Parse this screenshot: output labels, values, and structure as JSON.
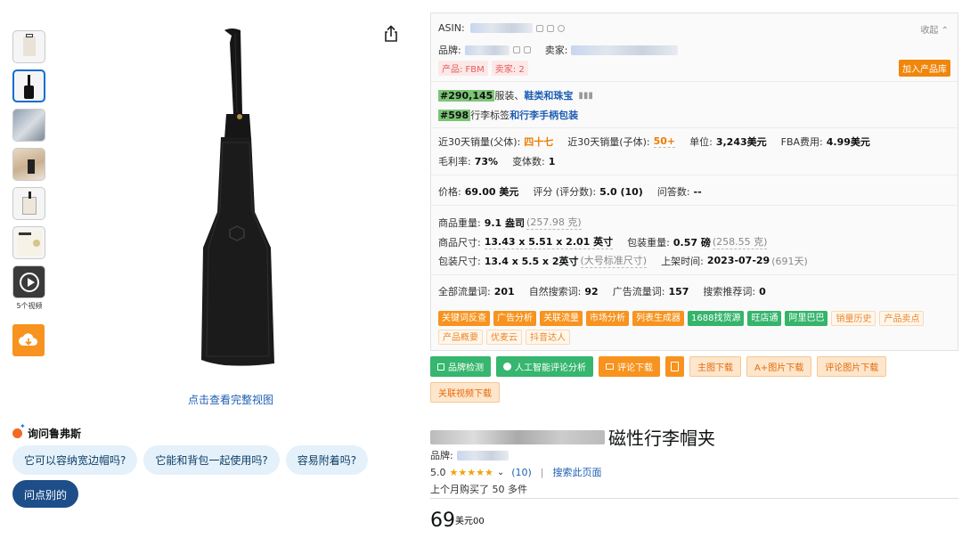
{
  "thumbs": {
    "video_count": "5个视频"
  },
  "main_image": {
    "full_view_link": "点击查看完整视图"
  },
  "rufus": {
    "title": "询问鲁弗斯",
    "chips": [
      "它可以容纳宽边帽吗?",
      "它能和背包一起使用吗?",
      "容易附着吗?"
    ],
    "ask_other": "问点别的"
  },
  "panel": {
    "asin_label": "ASIN:",
    "collapse": "收起",
    "brand_label": "品牌:",
    "seller_label": "卖家:",
    "tag_product": "产品: FBM",
    "tag_seller": "卖家: 2",
    "add_to_library": "加入产品库",
    "rank1_num": "#290,145",
    "rank1_cat_a": "服装、",
    "rank1_cat_b": "鞋类和珠宝",
    "rank2_num": "#598",
    "rank2_cat_a": "行李标签",
    "rank2_cat_b": "和行李手柄包装",
    "sales_parent_label": "近30天销量(父体):",
    "sales_parent_value": "四十七",
    "sales_child_label": "近30天销量(子体):",
    "sales_child_value": "50+",
    "unit_label": "单位:",
    "unit_value": "3,243美元",
    "fba_label": "FBA费用:",
    "fba_value": "4.99美元",
    "margin_label": "毛利率:",
    "margin_value": "73%",
    "variants_label": "变体数:",
    "variants_value": "1",
    "price_label": "价格:",
    "price_value": "69.00 美元",
    "rating_label": "评分 (评分数):",
    "rating_value": "5.0 (10)",
    "qa_label": "问答数:",
    "qa_value": "--",
    "weight_label": "商品重量:",
    "weight_value": "9.1 盎司",
    "weight_alt": "(257.98 克)",
    "size_label": "商品尺寸:",
    "size_value": "13.43 x 5.51 x 2.01 英寸",
    "pkg_weight_label": "包装重量:",
    "pkg_weight_value": "0.57 磅",
    "pkg_weight_alt": "(258.55 克)",
    "pkg_size_label": "包装尺寸:",
    "pkg_size_value": "13.4 x 5.5 x 2英寸",
    "pkg_size_alt": "(大号标准尺寸)",
    "listed_label": "上架时间:",
    "listed_value": "2023-07-29",
    "listed_alt": "(691天)",
    "traffic_all_label": "全部流量词:",
    "traffic_all_value": "201",
    "traffic_organic_label": "自然搜索词:",
    "traffic_organic_value": "92",
    "traffic_ad_label": "广告流量词:",
    "traffic_ad_value": "157",
    "traffic_suggest_label": "搜索推荐词:",
    "traffic_suggest_value": "0",
    "tools": [
      {
        "label": "关键词反查",
        "style": "orange"
      },
      {
        "label": "广告分析",
        "style": "orange"
      },
      {
        "label": "关联流量",
        "style": "orange"
      },
      {
        "label": "市场分析",
        "style": "orange"
      },
      {
        "label": "列表生成器",
        "style": "orange"
      },
      {
        "label": "1688找货源",
        "style": "green"
      },
      {
        "label": "旺店通",
        "style": "green"
      },
      {
        "label": "阿里巴巴",
        "style": "green"
      },
      {
        "label": "销量历史",
        "style": "outline"
      },
      {
        "label": "产品卖点",
        "style": "outline"
      },
      {
        "label": "产品概要",
        "style": "outline"
      },
      {
        "label": "优麦云",
        "style": "outline"
      },
      {
        "label": "抖音达人",
        "style": "outline"
      }
    ]
  },
  "actions": {
    "brand_check": "品牌检测",
    "ai_review": "人工智能评论分析",
    "review_download": "评论下载",
    "main_img_download": "主图下载",
    "aplus_download": "A+图片下载",
    "review_img_download": "评论图片下载",
    "related_video_download": "关联视频下载"
  },
  "product": {
    "title_suffix": "磁性行李帽夹",
    "brand_label": "品牌:",
    "rating": "5.0",
    "rating_count": "(10)",
    "search_page": "搜索此页面",
    "bought": "上个月购买了 50 多件",
    "price_whole": "69",
    "price_fraction": "美元00"
  },
  "colors": {
    "accent_orange": "#f7931e",
    "accent_green": "#35b46b",
    "link_blue": "#1f5fb4"
  }
}
